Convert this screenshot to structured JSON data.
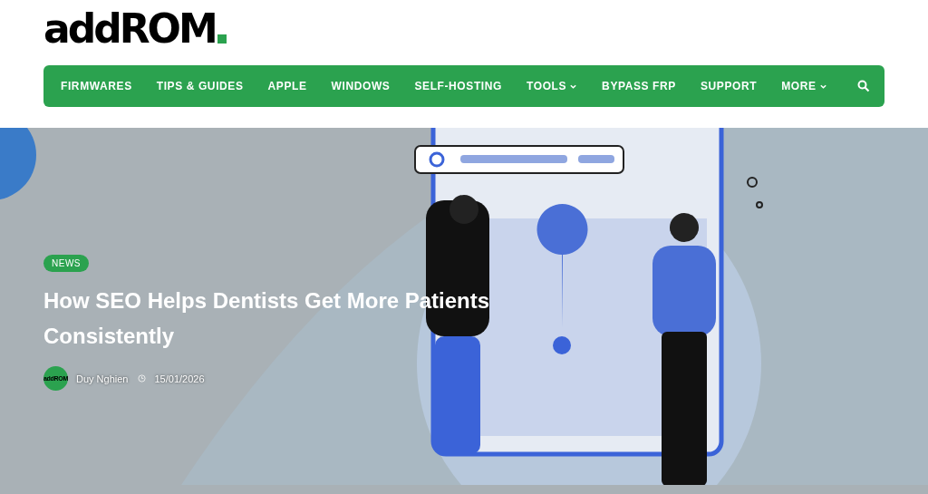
{
  "logo": {
    "text": "addROM"
  },
  "nav": {
    "items": [
      {
        "label": "FIRMWARES",
        "has_menu": false
      },
      {
        "label": "TIPS & GUIDES",
        "has_menu": false
      },
      {
        "label": "APPLE",
        "has_menu": false
      },
      {
        "label": "WINDOWS",
        "has_menu": false
      },
      {
        "label": "SELF-HOSTING",
        "has_menu": false
      },
      {
        "label": "TOOLS",
        "has_menu": true
      },
      {
        "label": "BYPASS FRP",
        "has_menu": false
      },
      {
        "label": "SUPPORT",
        "has_menu": false
      },
      {
        "label": "MORE",
        "has_menu": true
      }
    ]
  },
  "hero": {
    "category": "NEWS",
    "title": "How SEO Helps Dentists Get More Patients Consistently",
    "author": {
      "avatar_text": "addROM",
      "name": "Duy Nghien"
    },
    "date": "15/01/2026"
  }
}
